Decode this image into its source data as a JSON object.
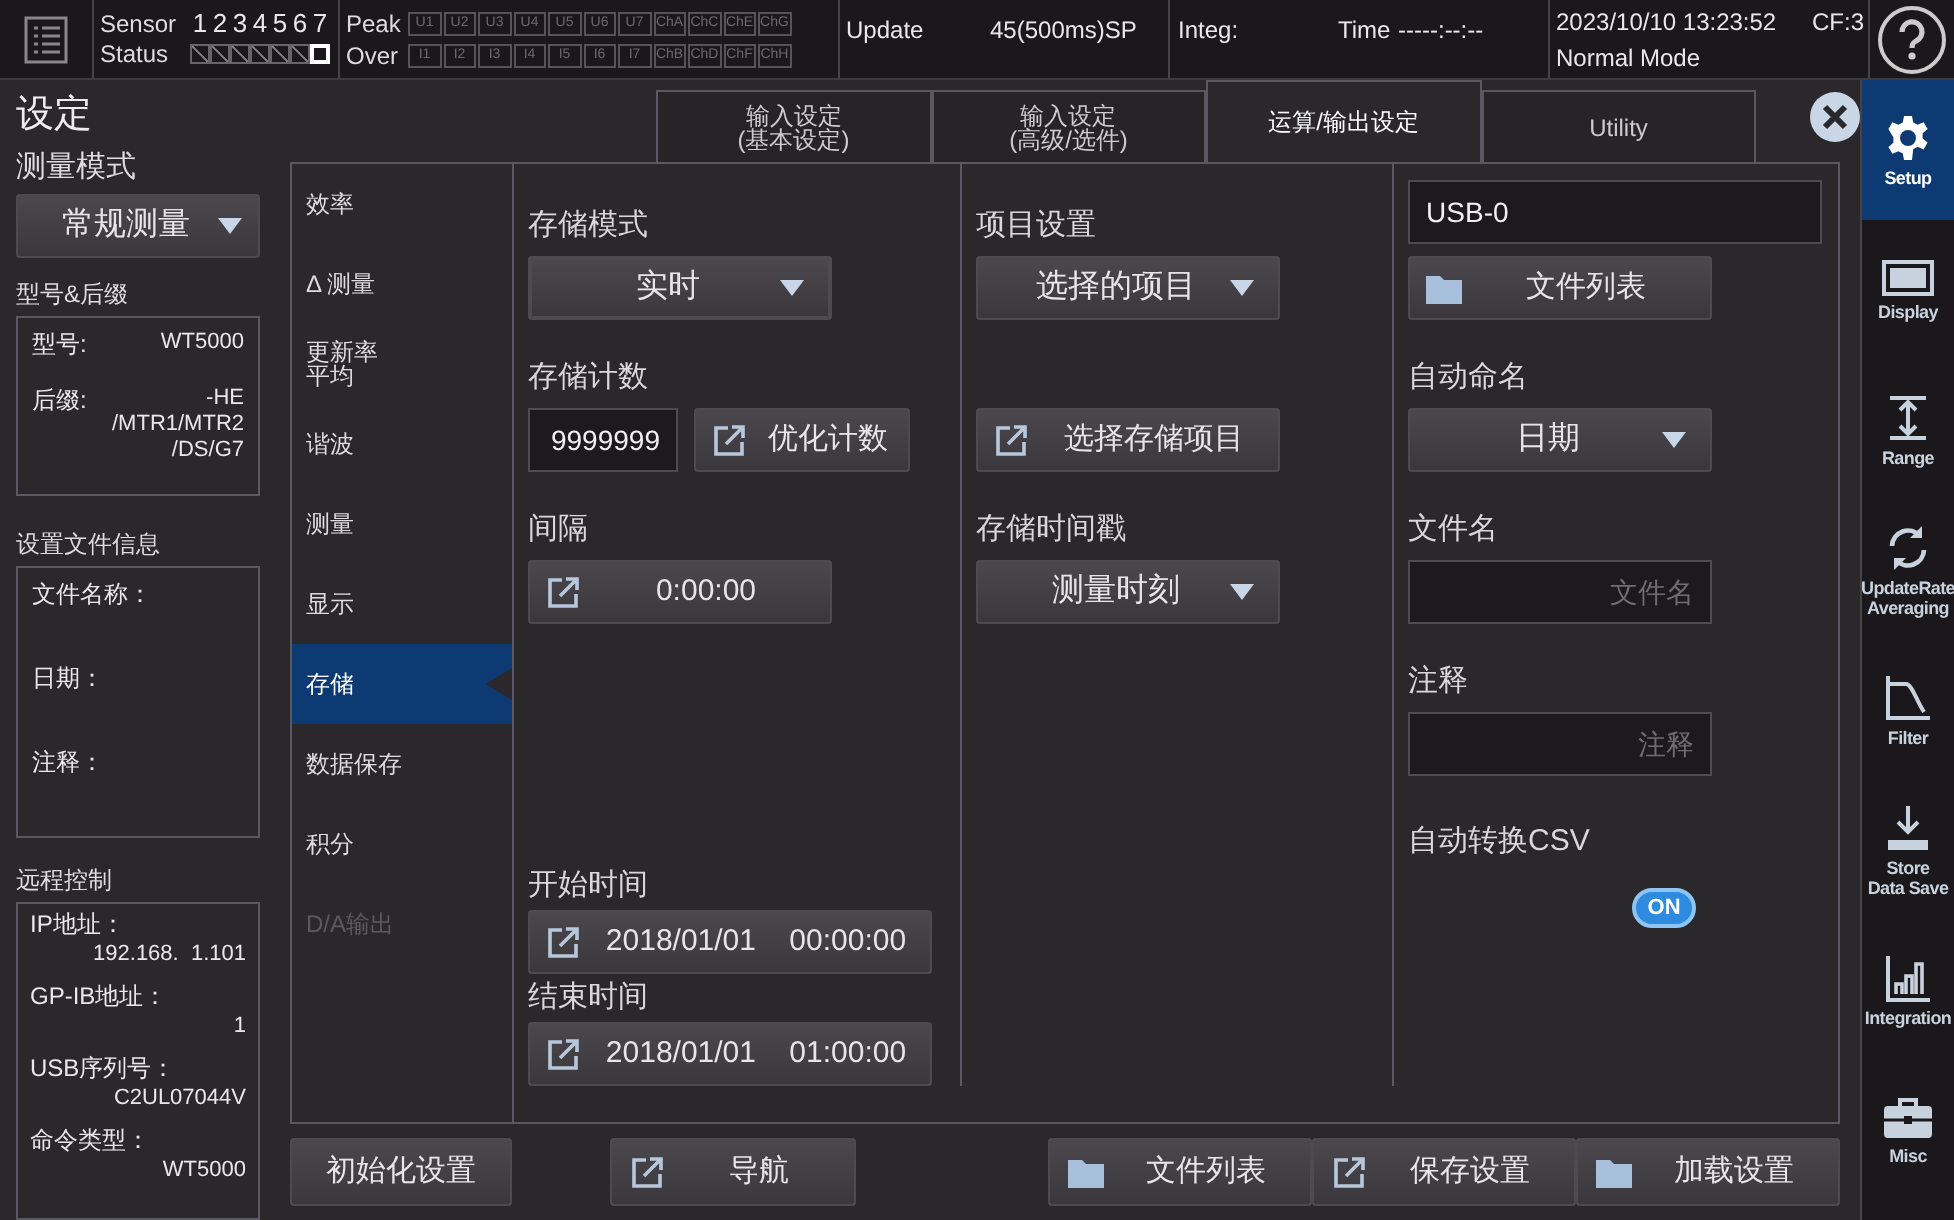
{
  "status_bar": {
    "sensor": {
      "label": "Sensor",
      "numbers": [
        "1",
        "2",
        "3",
        "4",
        "5",
        "6",
        "7"
      ]
    },
    "status": {
      "label": "Status",
      "cells": [
        {
          "kind": "hatched"
        },
        {
          "kind": "hatched"
        },
        {
          "kind": "hatched"
        },
        {
          "kind": "hatched"
        },
        {
          "kind": "hatched"
        },
        {
          "kind": "hatched"
        },
        {
          "kind": "empty"
        }
      ]
    },
    "peak": {
      "label": "Peak",
      "indicators": [
        "U1",
        "U2",
        "U3",
        "U4",
        "U5",
        "U6",
        "U7",
        "ChA",
        "ChC",
        "ChE",
        "ChG"
      ]
    },
    "over": {
      "label": "Over",
      "indicators": [
        "I1",
        "I2",
        "I3",
        "I4",
        "I5",
        "I6",
        "I7",
        "ChB",
        "ChD",
        "ChF",
        "ChH"
      ]
    },
    "update": {
      "label": "Update",
      "value": "45(500ms)SP"
    },
    "integ": {
      "label": "Integ:",
      "time_label": "Time",
      "time_value": "-----:--:--"
    },
    "datetime": "2023/10/10 13:23:52",
    "cf": "CF:3",
    "mode": "Normal Mode"
  },
  "title": "设定",
  "measure_mode": {
    "label": "测量模式",
    "value": "常规测量"
  },
  "model_info": {
    "heading": "型号&后缀",
    "rows": [
      {
        "label": "型号:",
        "value": "WT5000"
      },
      {
        "label": "后缀:",
        "value": "-HE\n/MTR1/MTR2\n/DS/G7"
      }
    ]
  },
  "file_info": {
    "heading": "设置文件信息",
    "labels": [
      "文件名称：",
      "日期：",
      "注释："
    ]
  },
  "remote": {
    "heading": "远程控制",
    "rows": [
      {
        "label": "IP地址：",
        "value": "192.168.  1.101"
      },
      {
        "label": "GP-IB地址：",
        "value": "1"
      },
      {
        "label": "USB序列号：",
        "value": "C2UL07044V"
      },
      {
        "label": "命令类型：",
        "value": "WT5000"
      }
    ]
  },
  "tabs": [
    {
      "label": "输入设定\n(基本设定)",
      "selected": false
    },
    {
      "label": "输入设定\n(高级/选件)",
      "selected": false
    },
    {
      "label": "运算/输出设定",
      "selected": true
    },
    {
      "label": "Utility",
      "selected": false
    }
  ],
  "menu": [
    {
      "label": "效率",
      "selected": false,
      "disabled": false
    },
    {
      "label": "Δ 测量",
      "selected": false,
      "disabled": false
    },
    {
      "label": "更新率平均",
      "selected": false,
      "disabled": false
    },
    {
      "label": "谐波",
      "selected": false,
      "disabled": false
    },
    {
      "label": "测量",
      "selected": false,
      "disabled": false
    },
    {
      "label": "显示",
      "selected": false,
      "disabled": false
    },
    {
      "label": "存储",
      "selected": true,
      "disabled": false
    },
    {
      "label": "数据保存",
      "selected": false,
      "disabled": false
    },
    {
      "label": "积分",
      "selected": false,
      "disabled": false
    },
    {
      "label": "D/A输出",
      "selected": false,
      "disabled": true
    }
  ],
  "columns": [
    {
      "top": [
        {
          "label": "存储模式",
          "controls": [
            {
              "kind": "dropdown",
              "value": "实时",
              "focused": true
            }
          ]
        },
        {
          "label": "存储计数",
          "controls": [
            {
              "kind": "field",
              "value": "9999999"
            },
            {
              "kind": "link-button",
              "text": "优化计数"
            }
          ]
        },
        {
          "label": "间隔",
          "controls": [
            {
              "kind": "link-button",
              "text": "0:00:00"
            }
          ]
        }
      ],
      "bottom": [
        {
          "label": "开始时间",
          "controls": [
            {
              "kind": "link-button",
              "text": "2018/01/01    00:00:00"
            }
          ]
        },
        {
          "label": "结束时间",
          "controls": [
            {
              "kind": "link-button",
              "text": "2018/01/01    01:00:00"
            }
          ]
        }
      ]
    },
    {
      "top": [
        {
          "label": "项目设置",
          "controls": [
            {
              "kind": "dropdown",
              "value": "选择的项目",
              "focused": false
            }
          ]
        },
        {
          "controls": [
            {
              "kind": "link-button",
              "text": "选择存储项目"
            }
          ]
        },
        {
          "label": "存储时间戳",
          "controls": [
            {
              "kind": "dropdown",
              "value": "测量时刻",
              "focused": false
            }
          ]
        }
      ]
    },
    {
      "top": [
        {
          "controls": [
            {
              "kind": "field",
              "value": "USB-0"
            },
            {
              "kind": "folder-button",
              "text": "文件列表"
            }
          ]
        },
        {
          "label": "自动命名",
          "controls": [
            {
              "kind": "dropdown",
              "value": "日期",
              "focused": false
            }
          ]
        },
        {
          "label": "文件名",
          "controls": [
            {
              "kind": "field",
              "placeholder": "文件名"
            }
          ]
        },
        {
          "label": "注释",
          "controls": [
            {
              "kind": "field",
              "placeholder": "注释"
            }
          ]
        },
        {
          "label": "自动转换CSV",
          "controls": [
            {
              "kind": "toggle",
              "on": true,
              "text": "ON"
            }
          ]
        }
      ]
    }
  ],
  "bottom_buttons": [
    {
      "kind": "button",
      "text": "初始化设置"
    },
    {
      "kind": "link-button",
      "text": "导航"
    },
    {
      "kind": "folder-button",
      "text": "文件列表"
    },
    {
      "kind": "link-button",
      "text": "保存设置"
    },
    {
      "kind": "folder-button",
      "text": "加载设置"
    }
  ],
  "sidebar": [
    {
      "label": "Setup",
      "selected": true
    },
    {
      "label": "Display",
      "selected": false
    },
    {
      "label": "Range",
      "selected": false
    },
    {
      "label": "UpdateRate\nAveraging",
      "selected": false
    },
    {
      "label": "Filter",
      "selected": false
    },
    {
      "label": "Store\nData Save",
      "selected": false
    },
    {
      "label": "Integration",
      "selected": false
    },
    {
      "label": "Misc",
      "selected": false
    }
  ]
}
